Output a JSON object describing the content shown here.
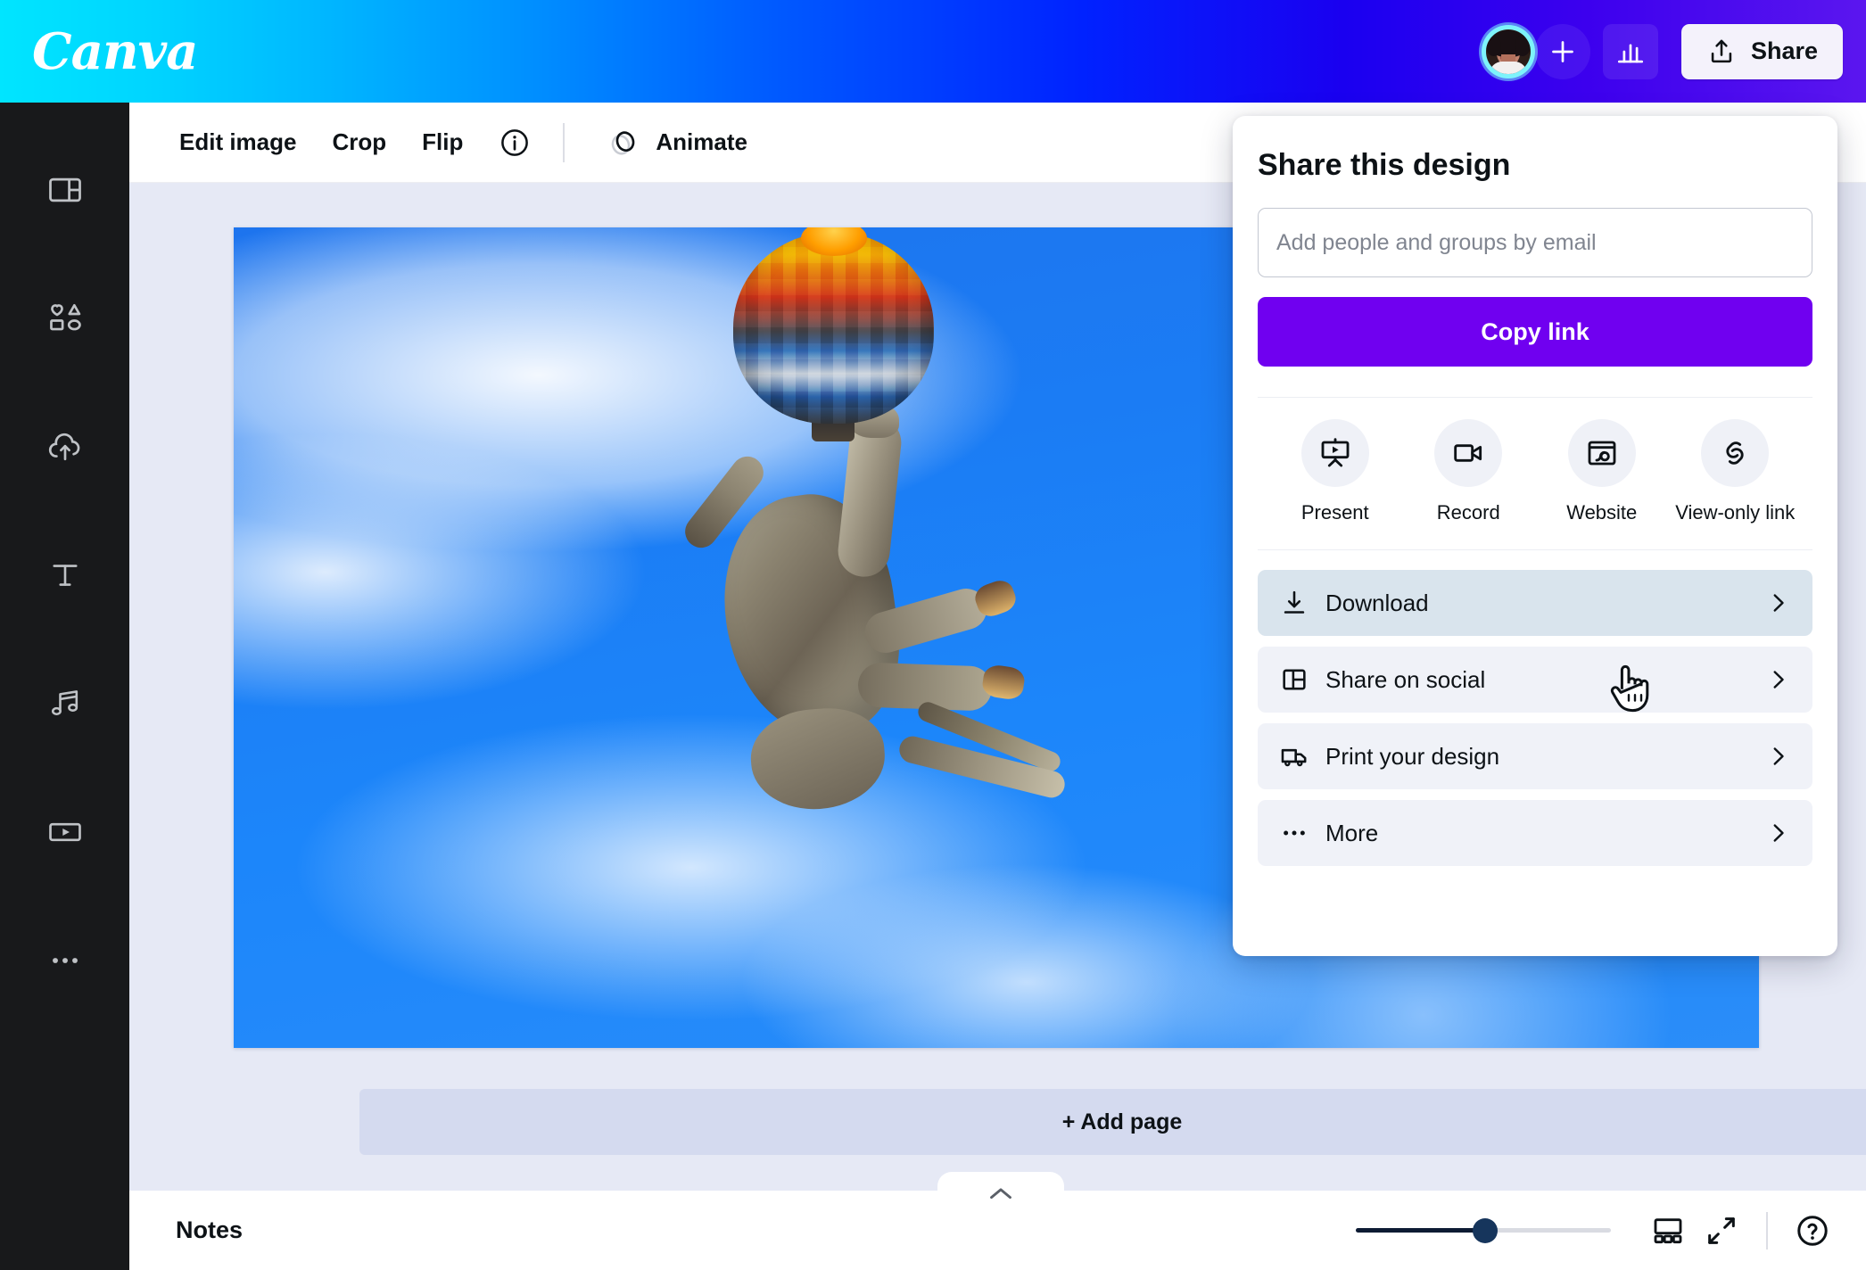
{
  "header": {
    "logo": "Canva",
    "avatar_name": "user-avatar",
    "add_collaborator_label": "+",
    "insights_icon": "bar-chart-icon",
    "share_label": "Share"
  },
  "toolbar": {
    "items": [
      {
        "label": "Edit image"
      },
      {
        "label": "Crop"
      },
      {
        "label": "Flip"
      }
    ],
    "info_icon": "info-icon",
    "animate_label": "Animate"
  },
  "sidebar": {
    "items": [
      {
        "name": "design-icon",
        "label": "Design"
      },
      {
        "name": "elements-icon",
        "label": "Elements"
      },
      {
        "name": "uploads-icon",
        "label": "Uploads"
      },
      {
        "name": "text-icon",
        "label": "Text"
      },
      {
        "name": "audio-icon",
        "label": "Audio"
      },
      {
        "name": "videos-icon",
        "label": "Videos"
      },
      {
        "name": "more-icon",
        "label": "More"
      }
    ]
  },
  "workspace": {
    "add_page_label": "+ Add page",
    "collapse_label": "collapse-panel"
  },
  "share_panel": {
    "title": "Share this design",
    "email_placeholder": "Add people and groups by email",
    "email_value": "",
    "copy_link_label": "Copy link",
    "quick_actions": [
      {
        "icon": "present-icon",
        "label": "Present"
      },
      {
        "icon": "record-icon",
        "label": "Record"
      },
      {
        "icon": "website-icon",
        "label": "Website"
      },
      {
        "icon": "view-only-link-icon",
        "label": "View-only link"
      }
    ],
    "menu_items": [
      {
        "icon": "download-icon",
        "label": "Download",
        "active": true
      },
      {
        "icon": "share-on-social-icon",
        "label": "Share on social",
        "active": false
      },
      {
        "icon": "print-truck-icon",
        "label": "Print your design",
        "active": false
      },
      {
        "icon": "more-dots-icon",
        "label": "More",
        "active": false
      }
    ]
  },
  "bottom_bar": {
    "notes_label": "Notes",
    "zoom_value": "50",
    "grid_view_icon": "grid-view-icon",
    "fullscreen_icon": "fullscreen-icon",
    "help_icon": "help-icon"
  },
  "colors": {
    "brand_purple": "#7000f0",
    "header_gradient_start": "#00e5ff",
    "header_gradient_end": "#5b16ef",
    "rail_bg": "#18191b",
    "workspace_bg": "#e6e9f5",
    "menu_active_bg": "#d9e4ed"
  }
}
